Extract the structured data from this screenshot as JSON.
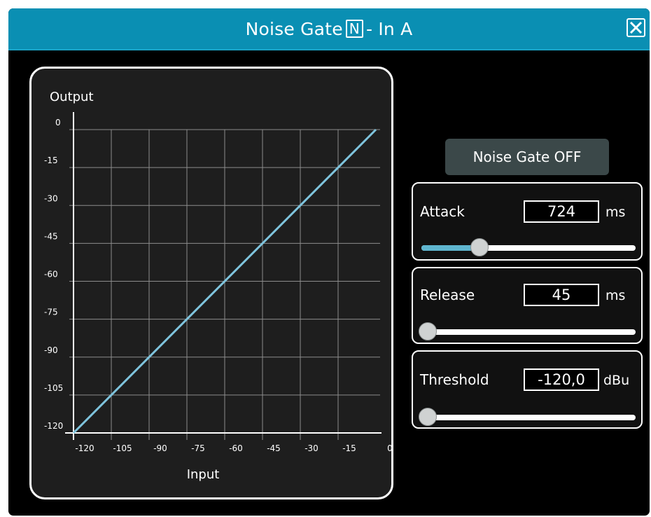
{
  "window": {
    "title_prefix": "Noise Gate",
    "title_badge": "N",
    "title_suffix": "- In A"
  },
  "graph": {
    "y_axis_title": "Output",
    "x_axis_title": "Input",
    "y_ticks": [
      "0",
      "-15",
      "-30",
      "-45",
      "-60",
      "-75",
      "-90",
      "-105",
      "-120"
    ],
    "x_ticks": [
      "-120",
      "-105",
      "-90",
      "-75",
      "-60",
      "-45",
      "-30",
      "-15",
      "0"
    ],
    "range": [
      -120,
      0
    ],
    "line_color": "#7fc4dd",
    "grid_color": "#8c8c8c",
    "curve": [
      {
        "input": -120,
        "output": -120
      },
      {
        "input": 0,
        "output": 0
      }
    ]
  },
  "gate_button": {
    "label": "Noise Gate OFF"
  },
  "controls": [
    {
      "id": "attack",
      "label": "Attack",
      "value": "724",
      "unit": "ms",
      "slider_fraction": 0.27,
      "fill": true
    },
    {
      "id": "release",
      "label": "Release",
      "value": "45",
      "unit": "ms",
      "slider_fraction": 0.03,
      "fill": false
    },
    {
      "id": "threshold",
      "label": "Threshold",
      "value": "-120,0",
      "unit": "dBu",
      "slider_fraction": 0.03,
      "fill": false
    }
  ],
  "colors": {
    "titlebar": "#0a8fb3",
    "accent": "#5fb6cf",
    "button": "#3b4849"
  }
}
